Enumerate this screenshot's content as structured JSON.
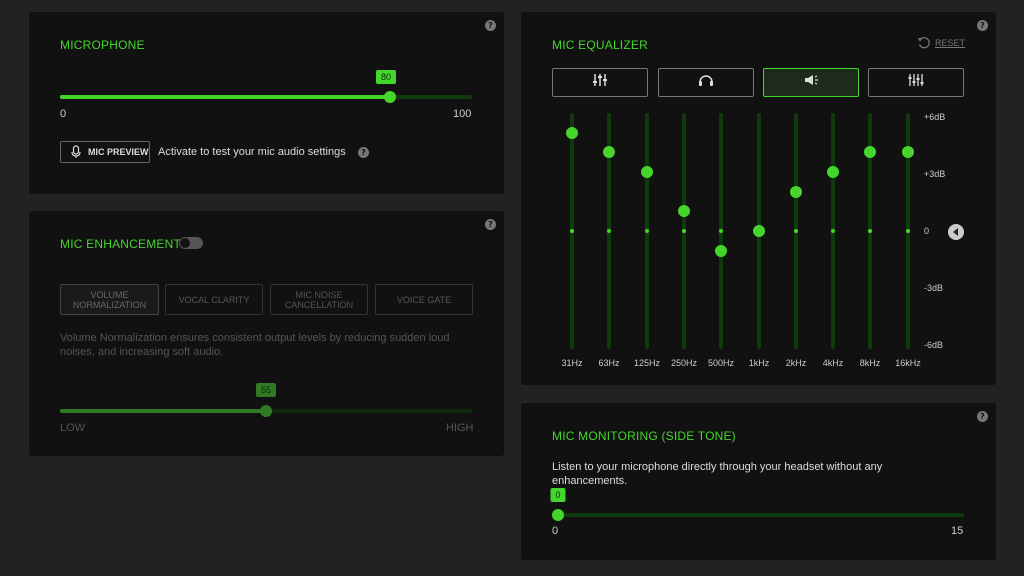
{
  "help_glyph": "?",
  "microphone": {
    "title": "MICROPHONE",
    "value": "80",
    "level": 80,
    "min": "0",
    "max": "100",
    "preview_button": "MIC PREVIEW",
    "preview_hint": "Activate to test your mic audio settings"
  },
  "enhancement": {
    "title": "MIC ENHANCEMENT",
    "toggle_on": false,
    "options": [
      {
        "label": "VOLUME NORMALIZATION",
        "selected": true
      },
      {
        "label": "VOCAL CLARITY",
        "selected": false
      },
      {
        "label": "MIC NOISE CANCELLATION",
        "selected": false
      },
      {
        "label": "VOICE GATE",
        "selected": false
      }
    ],
    "description": "Volume Normalization ensures consistent output levels by reducing sudden loud noises, and increasing soft audio.",
    "value": "55",
    "level": 50,
    "low_label": "LOW",
    "high_label": "HIGH"
  },
  "equalizer": {
    "title": "MIC EQUALIZER",
    "reset_label": "RESET",
    "presets": [
      {
        "icon": "sliders-icon",
        "active": false
      },
      {
        "icon": "headset-icon",
        "active": false
      },
      {
        "icon": "megaphone-icon",
        "active": true
      },
      {
        "icon": "equalizer-icon",
        "active": false
      }
    ],
    "db_labels": [
      "+6dB",
      "+3dB",
      "0",
      "-3dB",
      "-6dB"
    ],
    "bands": [
      {
        "freq": "31Hz",
        "db": 5
      },
      {
        "freq": "63Hz",
        "db": 4
      },
      {
        "freq": "125Hz",
        "db": 3
      },
      {
        "freq": "250Hz",
        "db": 1
      },
      {
        "freq": "500Hz",
        "db": -1
      },
      {
        "freq": "1kHz",
        "db": 0
      },
      {
        "freq": "2kHz",
        "db": 2
      },
      {
        "freq": "4kHz",
        "db": 3
      },
      {
        "freq": "8kHz",
        "db": 4
      },
      {
        "freq": "16kHz",
        "db": 4
      }
    ]
  },
  "monitoring": {
    "title": "MIC MONITORING (SIDE TONE)",
    "description": "Listen to your microphone directly through your headset without any enhancements.",
    "value": "0",
    "level": 0,
    "min": "0",
    "max": "15"
  },
  "colors": {
    "accent": "#44d62c",
    "panel": "#111111",
    "background": "#222222"
  }
}
